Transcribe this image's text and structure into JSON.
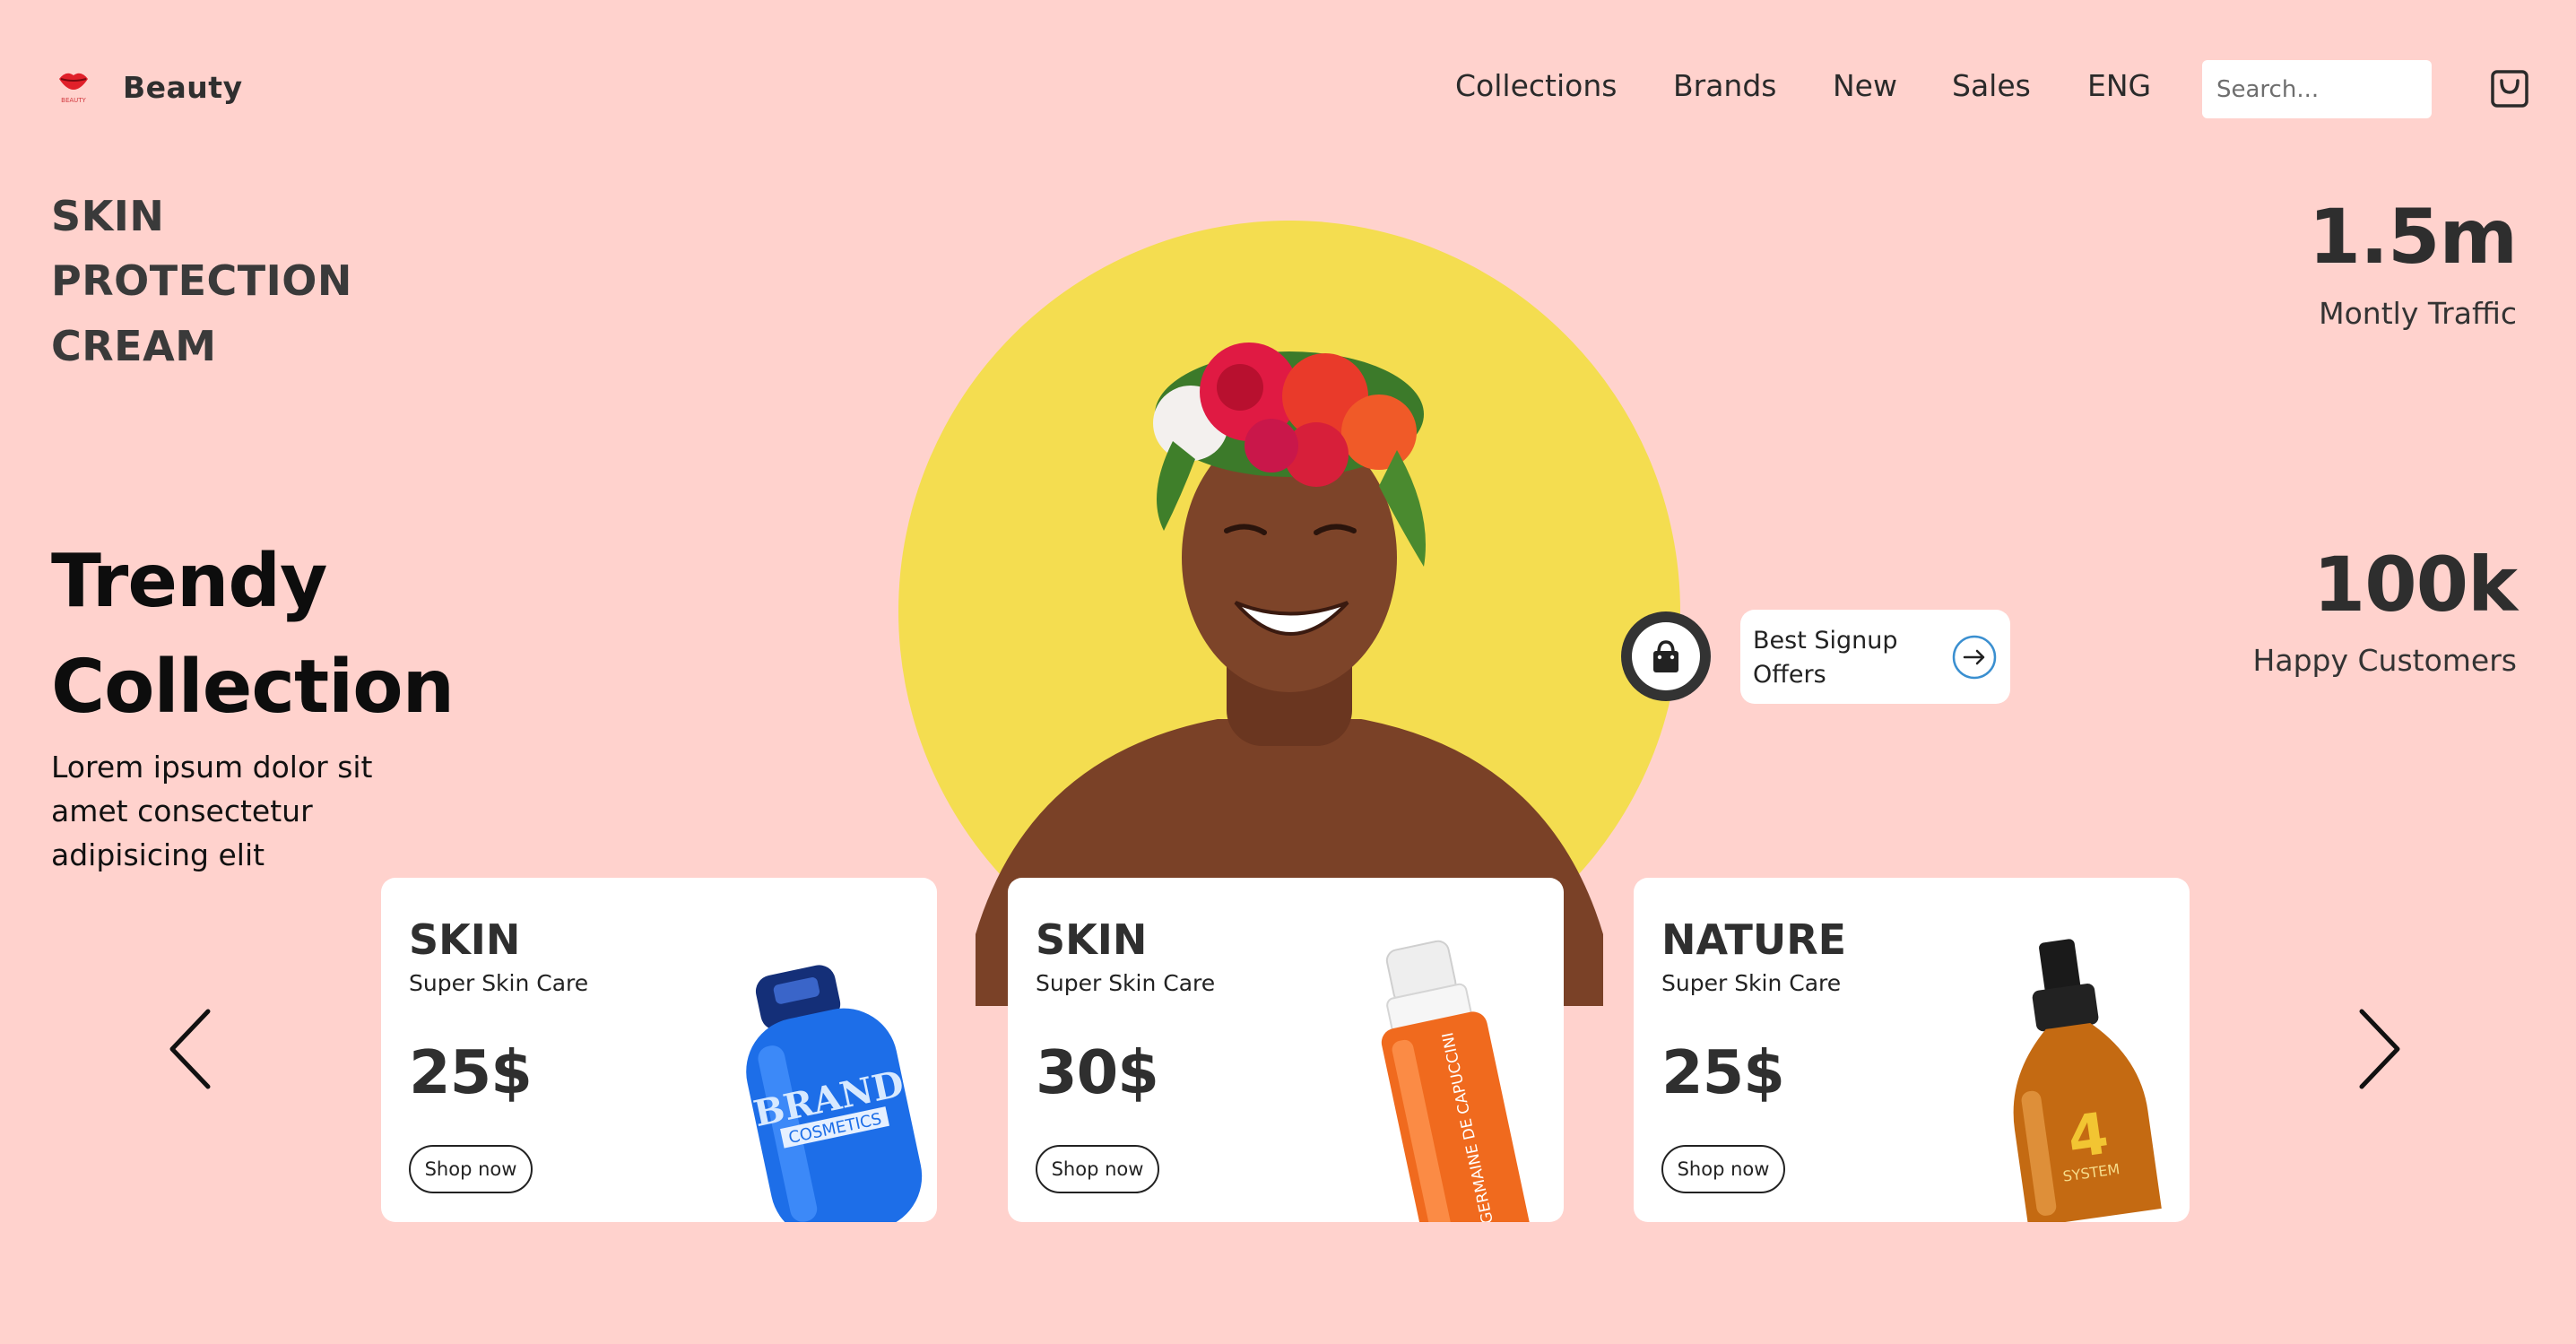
{
  "header": {
    "brand_name": "Beauty",
    "logo_caption": "BEAUTY",
    "nav": [
      "Collections",
      "Brands",
      "New",
      "Sales",
      "ENG"
    ],
    "search_placeholder": "Search...",
    "cart_icon": "shopping-bag-icon"
  },
  "hero": {
    "tagline_lines": [
      "SKIN",
      "PROTECTION",
      "CREAM"
    ],
    "heading_lines": [
      "Trendy",
      "Collection"
    ],
    "description_lines": [
      "Lorem ipsum dolor sit",
      "amet consectetur",
      "adipisicing elit"
    ],
    "circle_color": "#f4dd50"
  },
  "stats": [
    {
      "value": "1.5m",
      "label": "Montly Traffic"
    },
    {
      "value": "100k",
      "label": "Happy Customers"
    }
  ],
  "offer": {
    "text": "Best Signup Offers",
    "bag_icon": "shopping-bag-icon",
    "arrow_icon": "arrow-right-icon"
  },
  "products": [
    {
      "title": "SKIN",
      "subtitle": "Super Skin Care",
      "price": "25$",
      "button": "Shop now",
      "bottle_label": [
        "BRAND",
        "COSMETICS"
      ]
    },
    {
      "title": "SKIN",
      "subtitle": "Super Skin Care",
      "price": "30$",
      "button": "Shop now",
      "bottle_label": [
        "GERMAINE DE CAPUCCINI"
      ]
    },
    {
      "title": "NATURE",
      "subtitle": "Super Skin Care",
      "price": "25$",
      "button": "Shop now",
      "bottle_label": [
        "4",
        "SYSTEM"
      ]
    }
  ],
  "carousel": {
    "prev_icon": "chevron-left-icon",
    "next_icon": "chevron-right-icon"
  },
  "colors": {
    "background": "#ffd2cd",
    "accent_yellow": "#f4dd50",
    "text_dark": "#2f2f2f"
  }
}
